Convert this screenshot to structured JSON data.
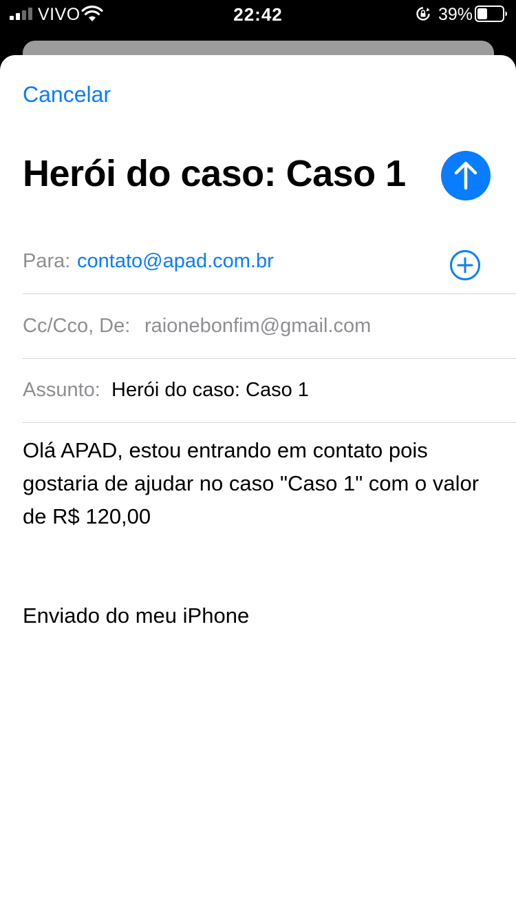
{
  "status_bar": {
    "carrier": "VIVO",
    "time": "22:42",
    "battery": "39%",
    "battery_level": 0.39,
    "signal_icon": "cellular-signal-icon",
    "wifi_icon": "wifi-icon",
    "rotation_icon": "rotation-lock-icon"
  },
  "compose": {
    "cancel_label": "Cancelar",
    "title": "Herói do caso: Caso 1",
    "send_icon": "arrow-up-icon",
    "to": {
      "label": "Para:",
      "value": "contato@apad.com.br",
      "add_icon": "plus-circle-icon"
    },
    "cc_from": {
      "label": "Cc/Cco, De:",
      "value": "raionebonfim@gmail.com"
    },
    "subject": {
      "label": "Assunto:",
      "value": "Herói do caso: Caso 1"
    },
    "body": "Olá APAD, estou entrando em contato pois gostaria de ajudar no caso \"Caso 1\" com o valor de R$ 120,00",
    "signature": "Enviado do meu iPhone"
  },
  "colors": {
    "accent": "#0a7cff",
    "secondary_text": "#8e8e93",
    "separator": "#d5d5d9"
  }
}
